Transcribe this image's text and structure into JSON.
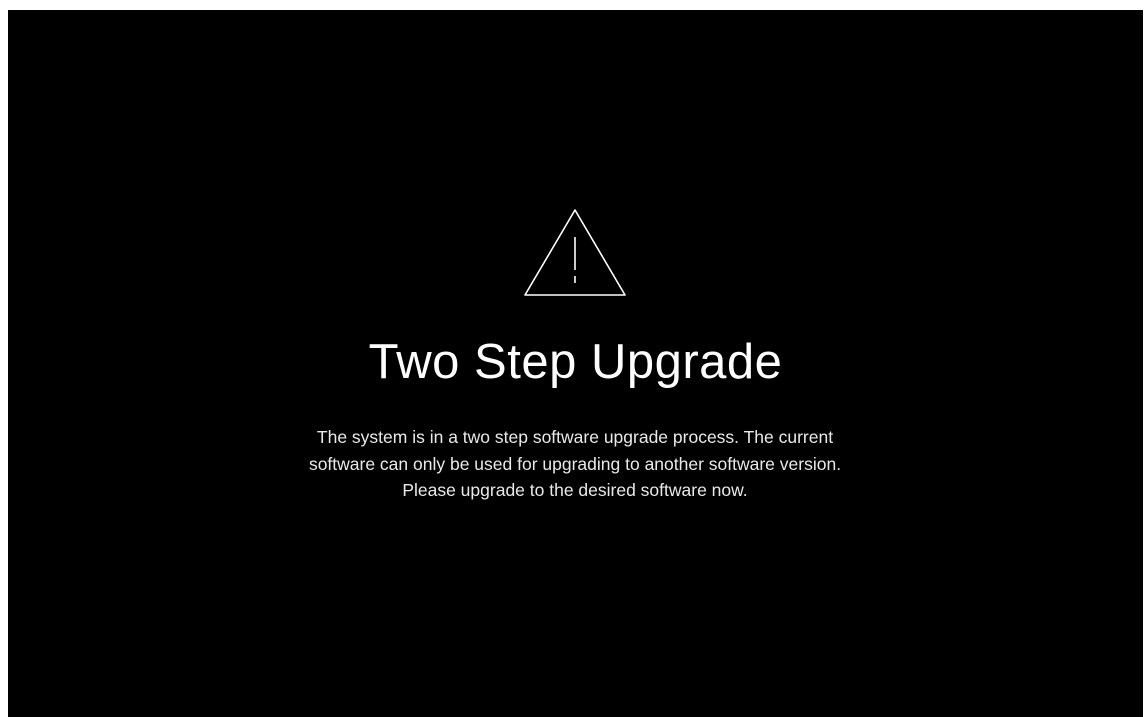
{
  "screen": {
    "icon": "warning-triangle-icon",
    "title": "Two Step Upgrade",
    "message": "The system is in a two step software upgrade process. The current software can only be used for upgrading to another software version. Please upgrade to the desired software now."
  },
  "colors": {
    "background": "#000000",
    "foreground": "#ffffff"
  }
}
